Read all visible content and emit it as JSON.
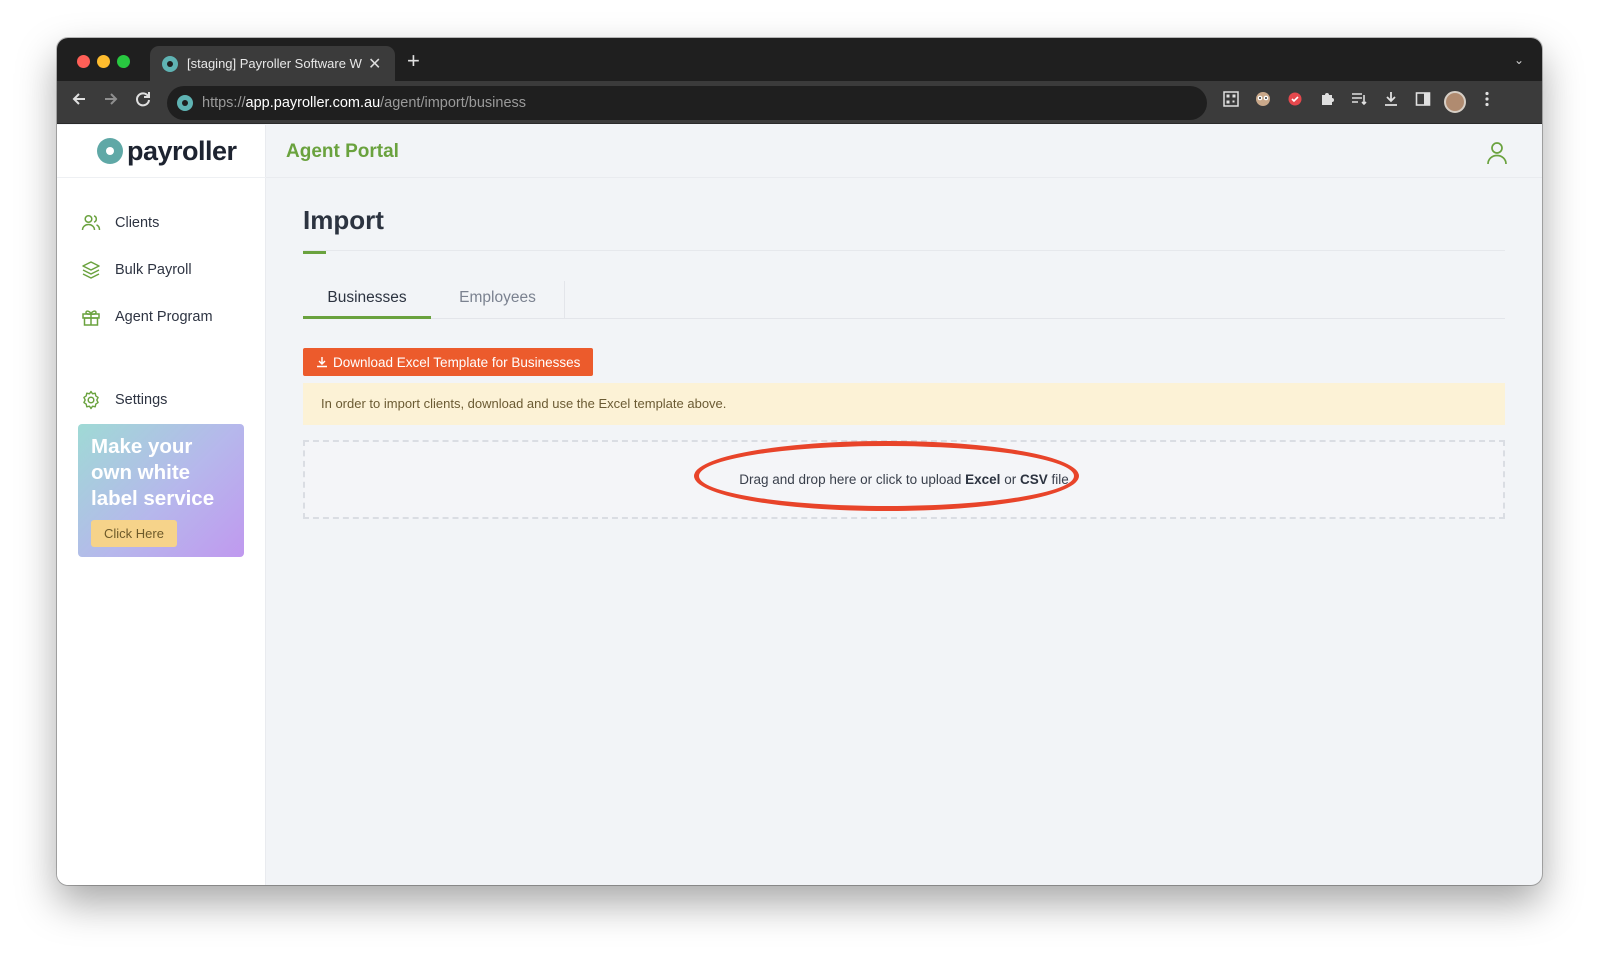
{
  "browser": {
    "tab_title": "[staging] Payroller Software W",
    "tab_close": "✕",
    "new_tab": "+",
    "tab_menu": "⌄",
    "url_scheme": "https://",
    "url_host": "app.payroller.com.au",
    "url_path": "/agent/import/business",
    "icons": [
      "qr-code-icon",
      "extension-eyes-icon",
      "extension-red-icon",
      "puzzle-icon",
      "reading-list-icon",
      "download-icon",
      "side-panel-icon",
      "profile-avatar-icon",
      "kebab-menu-icon"
    ]
  },
  "sidebar": {
    "logo_text": "payroller",
    "items": [
      {
        "label": "Clients",
        "icon": "users-icon"
      },
      {
        "label": "Bulk Payroll",
        "icon": "layers-icon"
      },
      {
        "label": "Agent Program",
        "icon": "gift-icon"
      },
      {
        "label": "Settings",
        "icon": "gear-icon"
      }
    ],
    "promo": {
      "title": "Make your own white label service",
      "button": "Click Here"
    }
  },
  "header": {
    "portal_title": "Agent Portal"
  },
  "main": {
    "title": "Import",
    "tabs": [
      {
        "label": "Businesses",
        "active": true
      },
      {
        "label": "Employees",
        "active": false
      }
    ],
    "download_button": "Download Excel Template for Businesses",
    "notice": "In order to import clients, download and use the Excel template above.",
    "dropzone": {
      "prefix": "Drag and drop here or click to upload ",
      "format1": "Excel",
      "middle": " or ",
      "format2": "CSV",
      "suffix": " file"
    }
  },
  "colors": {
    "brand_green": "#6aa23e",
    "button_orange": "#ec5b2c",
    "notice_bg": "#fcf2d6",
    "highlight_red": "#e8442a"
  }
}
